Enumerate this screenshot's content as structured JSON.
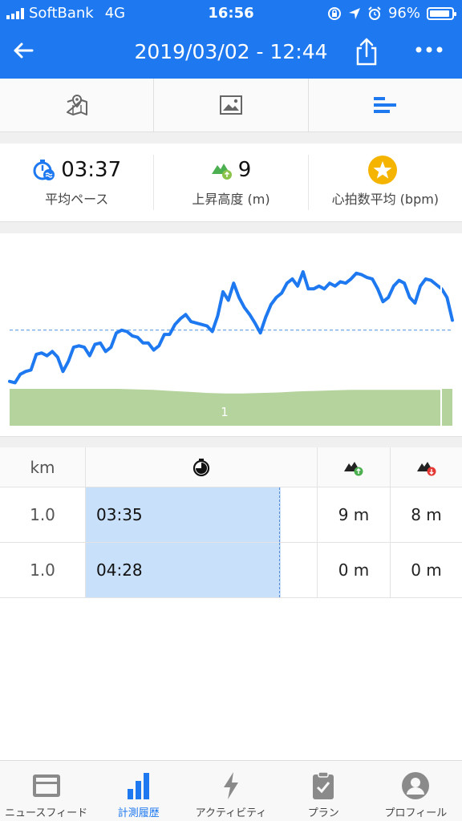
{
  "status_bar": {
    "carrier": "SoftBank",
    "network": "4G",
    "time": "16:56",
    "battery": "96%"
  },
  "header": {
    "title": "2019/03/02 - 12:44",
    "back_icon": "back-arrow-icon",
    "share_icon": "share-icon",
    "more_icon": "more-icon",
    "bg_color": "#1e79f0"
  },
  "tabs": [
    {
      "icon": "map-icon",
      "active": false
    },
    {
      "icon": "image-icon",
      "active": false
    },
    {
      "icon": "splits-icon",
      "active": true
    }
  ],
  "stats": {
    "pace": {
      "value": "03:37",
      "label": "平均ペース",
      "icon": "stopwatch-icon"
    },
    "ascent": {
      "value": "9",
      "label": "上昇高度 (m)",
      "icon": "ascent-icon"
    },
    "heart_rate": {
      "value": "",
      "label": "心拍数平均 (bpm)",
      "icon": "star-badge-icon"
    }
  },
  "chart_data": {
    "type": "line",
    "series": [
      {
        "values": [
          3,
          2,
          8,
          10,
          11,
          22,
          23,
          21,
          24,
          20,
          10,
          17,
          27,
          28,
          27,
          21,
          29,
          30,
          24,
          27,
          37,
          39,
          38,
          35,
          34,
          30,
          30,
          25,
          28,
          36,
          36,
          43,
          47,
          50,
          45,
          44,
          43,
          42,
          38,
          49,
          66,
          60,
          72,
          62,
          55,
          50,
          44,
          37,
          48,
          57,
          62,
          65,
          72,
          75,
          70,
          80,
          68,
          68,
          70,
          68,
          72,
          70,
          73,
          72,
          75,
          79,
          78,
          76,
          75,
          68,
          59,
          62,
          70,
          74,
          72,
          62,
          58,
          70,
          75,
          74,
          71,
          68,
          62,
          46
        ]
      }
    ],
    "reference_value": 39,
    "elevation_profile": [
      72,
      72,
      72,
      72,
      72,
      72,
      72,
      71,
      70,
      68,
      66,
      64,
      63,
      63,
      64,
      65,
      67,
      68,
      69,
      70,
      70,
      70,
      70,
      70,
      70
    ],
    "segment_label": "1",
    "line_color": "#1e79f0",
    "elevation_color": "#b5d39c"
  },
  "splits": {
    "headers": {
      "distance": "km",
      "pace_icon": "stopwatch-icon",
      "ascent_icon": "ascent-icon",
      "descent_icon": "descent-icon"
    },
    "rows": [
      {
        "km": "1.0",
        "pace": "03:35",
        "pace_fraction": 0.84,
        "ascent": "9 m",
        "descent": "8 m"
      },
      {
        "km": "1.0",
        "pace": "04:28",
        "pace_fraction": 0.84,
        "ascent": "0 m",
        "descent": "0 m"
      }
    ]
  },
  "bottom_nav": [
    {
      "label": "ニュースフィード",
      "icon": "newsfeed-icon",
      "active": false
    },
    {
      "label": "計測履歴",
      "icon": "history-chart-icon",
      "active": true
    },
    {
      "label": "アクティビティ",
      "icon": "activity-bolt-icon",
      "active": false
    },
    {
      "label": "プラン",
      "icon": "plan-clipboard-icon",
      "active": false
    },
    {
      "label": "プロフィール",
      "icon": "profile-icon",
      "active": false
    }
  ]
}
